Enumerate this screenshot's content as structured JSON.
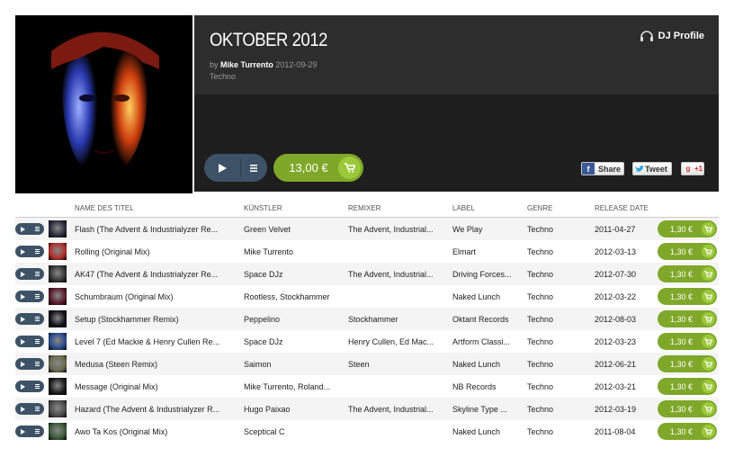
{
  "release": {
    "title": "OKTOBER 2012",
    "by_prefix": "by",
    "artist": "Mike Turrento",
    "date": "2012-09-29",
    "genre": "Techno",
    "dj_profile_label": "DJ Profile",
    "price": "13,00 €"
  },
  "share": {
    "facebook": "Share",
    "twitter": "Tweet",
    "google": "+1"
  },
  "columns": {
    "title": "NAME DES TITEL",
    "artist": "KÜNSTLER",
    "remixer": "REMIXER",
    "label": "LABEL",
    "genre": "GENRE",
    "release_date": "RELEASE DATE"
  },
  "tracks": [
    {
      "title": "Flash (The Advent & Industrialyzer Re...",
      "artist": "Green Velvet",
      "remixer": "The Advent, Industrial...",
      "label": "We Play",
      "genre": "Techno",
      "date": "2011-04-27",
      "price": "1,30 €",
      "thumb": "#2a2a3a"
    },
    {
      "title": "Rolling (Original Mix)",
      "artist": "Mike Turrento",
      "remixer": "",
      "label": "Elmart",
      "genre": "Techno",
      "date": "2012-03-13",
      "price": "1,30 €",
      "thumb": "#b0302a"
    },
    {
      "title": "AK47 (The Advent & Industrialyzer Re...",
      "artist": "Space DJz",
      "remixer": "The Advent, Industrial...",
      "label": "Driving Forces...",
      "genre": "Techno",
      "date": "2012-07-30",
      "price": "1,30 €",
      "thumb": "#333333"
    },
    {
      "title": "Schumbraum (Original Mix)",
      "artist": "Rootless, Stockhammer",
      "remixer": "",
      "label": "Naked Lunch",
      "genre": "Techno",
      "date": "2012-03-22",
      "price": "1,30 €",
      "thumb": "#5a1a2a"
    },
    {
      "title": "Setup (Stockhammer Remix)",
      "artist": "Peppelino",
      "remixer": "Stockhammer",
      "label": "Oktant Records",
      "genre": "Techno",
      "date": "2012-08-03",
      "price": "1,30 €",
      "thumb": "#101018"
    },
    {
      "title": "Level 7 (Ed Mackie & Henry Cullen Re...",
      "artist": "Space DJz",
      "remixer": "Henry Cullen, Ed Mac...",
      "label": "Artform Classi...",
      "genre": "Techno",
      "date": "2012-03-23",
      "price": "1,30 €",
      "thumb": "#2a4a8a"
    },
    {
      "title": "Medusa (Steen Remix)",
      "artist": "Saimon",
      "remixer": "Steen",
      "label": "Naked Lunch",
      "genre": "Techno",
      "date": "2012-06-21",
      "price": "1,30 €",
      "thumb": "#6a6a50"
    },
    {
      "title": "Message (Original Mix)",
      "artist": "Mike Turrento, Roland...",
      "remixer": "",
      "label": "NB Records",
      "genre": "Techno",
      "date": "2012-03-21",
      "price": "1,30 €",
      "thumb": "#1a1a1a"
    },
    {
      "title": "Hazard (The Advent & Industrialyzer R...",
      "artist": "Hugo Paixao",
      "remixer": "The Advent, Industrial...",
      "label": "Skyline Type ...",
      "genre": "Techno",
      "date": "2012-03-19",
      "price": "1,30 €",
      "thumb": "#4a4a4a"
    },
    {
      "title": "Awo Ta Kos (Original Mix)",
      "artist": "Sceptical C",
      "remixer": "",
      "label": "Naked Lunch",
      "genre": "Techno",
      "date": "2011-08-04",
      "price": "1,30 €",
      "thumb": "#3a5a3a"
    }
  ]
}
